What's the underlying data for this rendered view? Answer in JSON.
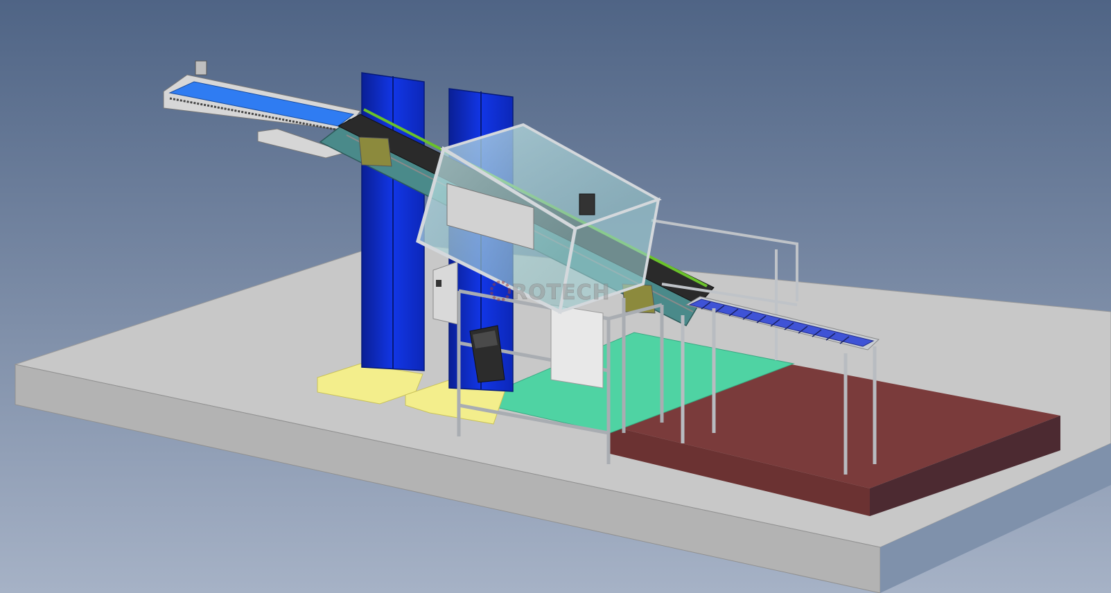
{
  "watermark": {
    "text": "ROTECH"
  },
  "colors": {
    "background_top": "#4f6485",
    "background_bottom": "#a6b2c6",
    "floor_slab": "#c6c6c6",
    "floor_front": "#b4b4b4",
    "floor_side": "#7f91ab",
    "red_platform": "#7a3b3b",
    "red_platform_front": "#6b3232",
    "red_platform_side": "#4c2a31",
    "column_blue": "#0f2fd8",
    "column_blue_shade": "#0a1f95",
    "base_yellow": "#f3ee8c",
    "green_floor": "#4fd3a3",
    "conveyor_blue": "#2f7cf2",
    "roller_blue": "#3f53d6",
    "aluminium_frame": "#c9cdd2",
    "glass": "#a9d7d7",
    "rail_green": "#6ac22a"
  },
  "icons": {
    "watermark_gear": "gear-icon"
  }
}
